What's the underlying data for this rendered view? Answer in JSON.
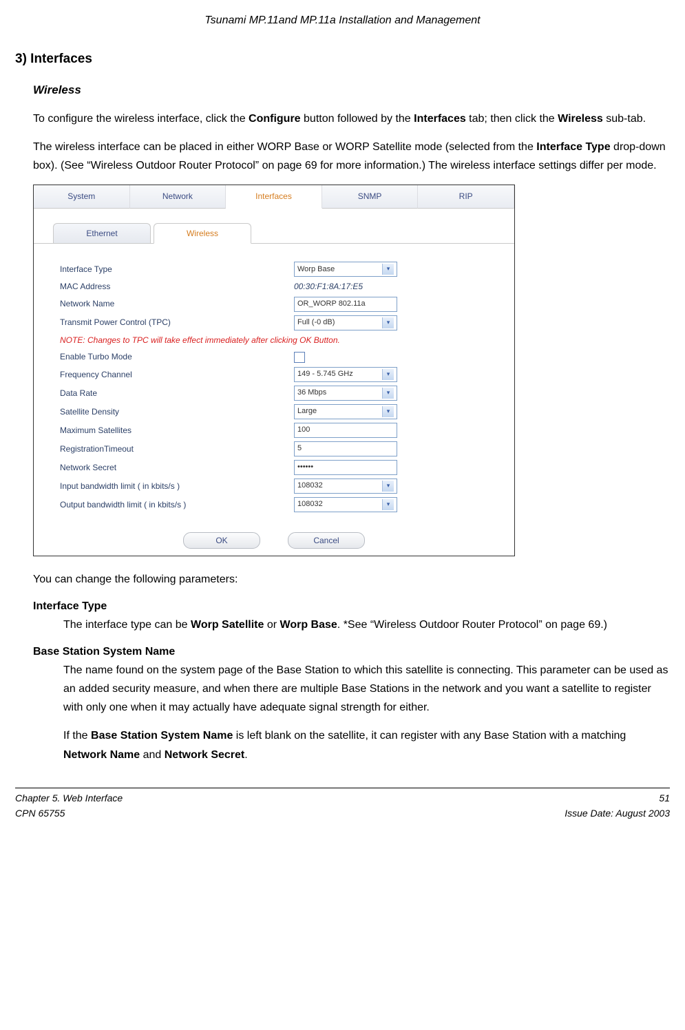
{
  "doc_title": "Tsunami MP.11and MP.11a Installation and Management",
  "section_title": "3) Interfaces",
  "wireless_heading": "Wireless",
  "intro1_pre": "To configure the wireless interface, click the ",
  "intro1_b1": "Configure",
  "intro1_mid1": " button followed by the ",
  "intro1_b2": "Interfaces",
  "intro1_mid2": " tab; then click the ",
  "intro1_b3": "Wireless",
  "intro1_post": " sub-tab.",
  "intro2_pre": "The wireless interface can be placed in either WORP Base or WORP Satellite mode (selected from the ",
  "intro2_b1": "Interface Type",
  "intro2_post": " drop-down box).  (See “Wireless Outdoor Router Protocol” on page 69 for more information.)  The wireless interface settings differ per mode.",
  "tabs": {
    "system": "System",
    "network": "Network",
    "interfaces": "Interfaces",
    "snmp": "SNMP",
    "rip": "RIP"
  },
  "subtabs": {
    "ethernet": "Ethernet",
    "wireless": "Wireless"
  },
  "form": {
    "interface_type_label": "Interface Type",
    "interface_type_value": "Worp Base",
    "mac_label": "MAC Address",
    "mac_value": "00:30:F1:8A:17:E5",
    "network_name_label": "Network Name",
    "network_name_value": "OR_WORP 802.11a",
    "tpc_label": "Transmit Power Control (TPC)",
    "tpc_value": "Full (-0 dB)",
    "tpc_note": "NOTE: Changes to TPC will take effect immediately after clicking OK Button.",
    "turbo_label": "Enable Turbo Mode",
    "freq_label": "Frequency Channel",
    "freq_value": "149 - 5.745 GHz",
    "rate_label": "Data Rate",
    "rate_value": "36 Mbps",
    "density_label": "Satellite Density",
    "density_value": "Large",
    "maxsat_label": "Maximum Satellites",
    "maxsat_value": "100",
    "regto_label": "RegistrationTimeout",
    "regto_value": "5",
    "secret_label": "Network Secret",
    "secret_value": "••••••",
    "inbw_label": "Input bandwidth limit ( in kbits/s )",
    "inbw_value": "108032",
    "outbw_label": "Output bandwidth limit ( in kbits/s )",
    "outbw_value": "108032",
    "ok": "OK",
    "cancel": "Cancel"
  },
  "after_panel": "You can change the following parameters:",
  "p1_title": "Interface Type",
  "p1_body_pre": "The interface type can be ",
  "p1_b1": "Worp Satellite",
  "p1_mid": " or ",
  "p1_b2": "Worp Base",
  "p1_body_post": ".  *See “Wireless Outdoor Router Protocol” on page 69.)",
  "p2_title": "Base Station System Name",
  "p2_body": "The name found on the system page of the Base Station to which this satellite is connecting. This parameter can be used as an added security measure, and when there are multiple Base Stations in the network and you want a satellite to register with only one when it may actually have adequate signal strength for either.",
  "p2b_pre": "If the ",
  "p2b_b1": "Base Station System Name",
  "p2b_mid1": " is left blank on the satellite, it can register with any Base Station with a matching ",
  "p2b_b2": "Network Name",
  "p2b_mid2": " and ",
  "p2b_b3": "Network Secret",
  "p2b_post": ".",
  "footer": {
    "chapter": "Chapter 5.  Web Interface",
    "cpn": "CPN 65755",
    "page": "51",
    "issue": "Issue Date:  August 2003"
  }
}
